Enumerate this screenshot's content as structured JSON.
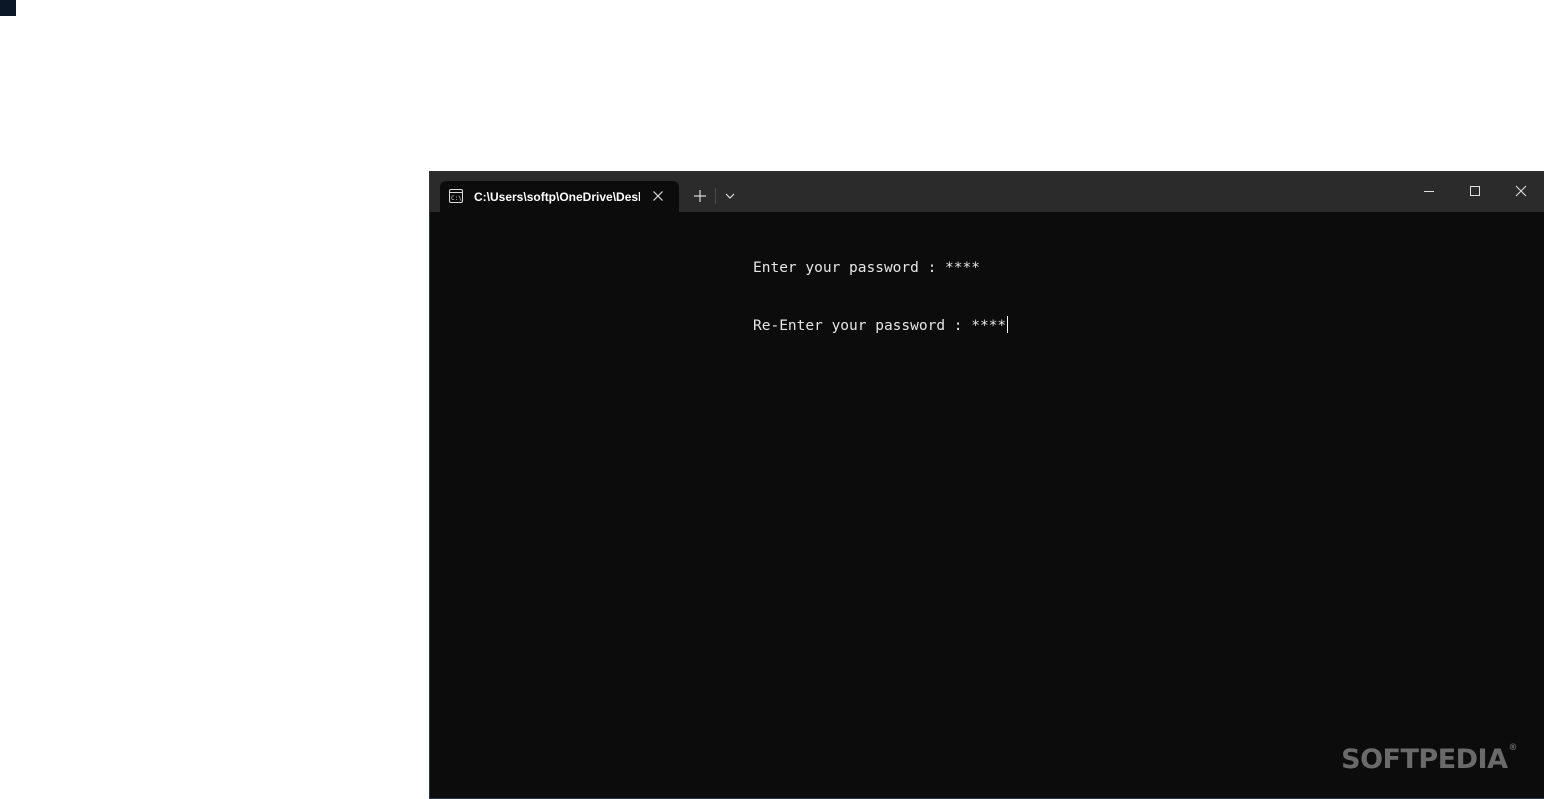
{
  "window": {
    "tab_title": "C:\\Users\\softp\\OneDrive\\Desk",
    "tab_icon": "console-icon"
  },
  "titlebar_buttons": {
    "new_tab_icon": "plus-icon",
    "dropdown_icon": "chevron-down-icon",
    "minimize_icon": "minimize-icon",
    "maximize_icon": "maximize-icon",
    "close_icon": "close-icon"
  },
  "terminal": {
    "lines": [
      "Enter your password : ****",
      "Re-Enter your password : ****"
    ]
  },
  "watermark": {
    "text": "SOFTPEDIA",
    "mark": "®"
  },
  "colors": {
    "titlebar": "#2b2b2b",
    "terminal_bg": "#0c0c0c",
    "text": "#e6e6e6"
  }
}
